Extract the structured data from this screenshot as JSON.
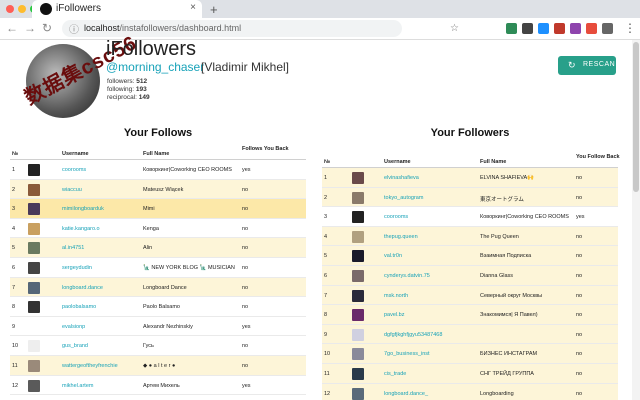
{
  "browser": {
    "tab_title": "iFollowers",
    "tab_close": "×",
    "new_tab": "+",
    "url_host": "localhost",
    "url_path": "/instafollowers/dashboard.html",
    "back": "←",
    "forward": "→",
    "reload": "↻",
    "secure_icon": "ⓘ",
    "star_icon": "☆",
    "menu_icon": "⋮"
  },
  "header": {
    "app_title": "iFollowers",
    "username": "@morning_chaser",
    "full_name": "[Vladimir Mikhel]",
    "stamp_text": "数据集csc56",
    "stats": {
      "followers_label": "followers:",
      "followers_value": "512",
      "following_label": "following:",
      "following_value": "193",
      "reciprocal_label": "reciprocal:",
      "reciprocal_value": "149"
    },
    "rescan_label": "RESCAN",
    "rescan_icon": "↻"
  },
  "follows": {
    "title": "Your Follows",
    "headers": {
      "num": "№",
      "pic": "",
      "username": "Username",
      "full_name": "Full Name",
      "back": "Follows You Back"
    },
    "rows": [
      {
        "n": "1",
        "username": "coorooms",
        "full_name": "Коворкинг|Coworking CEO ROOMS",
        "back": "yes",
        "color": "#222222",
        "hl": false
      },
      {
        "n": "2",
        "username": "wiaccuu",
        "full_name": "Mateusz Wiącek",
        "back": "no",
        "color": "#8a5a3a",
        "hl": true
      },
      {
        "n": "3",
        "username": "mimilongboarduk",
        "full_name": "Mimi",
        "back": "no",
        "color": "#4a3a5a",
        "hl": "strong"
      },
      {
        "n": "4",
        "username": "katie.kangaro.o",
        "full_name": "Kenga",
        "back": "no",
        "color": "#c9a060",
        "hl": false
      },
      {
        "n": "5",
        "username": "al.in4751",
        "full_name": "Alin",
        "back": "no",
        "color": "#6a7a60",
        "hl": true
      },
      {
        "n": "6",
        "username": "sergeydudin",
        "full_name": "🗽 NEW YORK BLOG 🗽 MUSICIAN",
        "back": "no",
        "color": "#444444",
        "hl": false
      },
      {
        "n": "7",
        "username": "longboard.dance",
        "full_name": "Longboard Dance",
        "back": "no",
        "color": "#556677",
        "hl": true
      },
      {
        "n": "8",
        "username": "paolobalsamo",
        "full_name": "Paolo Balsamo",
        "back": "no",
        "color": "#333333",
        "hl": false
      },
      {
        "n": "9",
        "username": "evalsionp",
        "full_name": "Alexandr Nezhinskiy",
        "back": "yes",
        "color": "#ffffff",
        "hl": false
      },
      {
        "n": "10",
        "username": "gus_brand",
        "full_name": "Гусь",
        "back": "no",
        "color": "#eeeeee",
        "hl": false
      },
      {
        "n": "11",
        "username": "wattergeoftheyfrenchie",
        "full_name": "◆ ● a l t e r ●",
        "back": "no",
        "color": "#9a8a7a",
        "hl": true
      },
      {
        "n": "12",
        "username": "mikhel.artem",
        "full_name": "Артем Михель",
        "back": "yes",
        "color": "#5a5a5a",
        "hl": false
      }
    ]
  },
  "followers": {
    "title": "Your Followers",
    "headers": {
      "num": "№",
      "pic": "",
      "username": "Username",
      "full_name": "Full Name",
      "back": "You Follow Back"
    },
    "rows": [
      {
        "n": "1",
        "username": "elvinashafieva",
        "full_name": "ELVINA SHAFIEVA🙌",
        "back": "no",
        "color": "#6a4a4a",
        "hl": true
      },
      {
        "n": "2",
        "username": "tokyo_autogram",
        "full_name": "東京オートグラム",
        "back": "no",
        "color": "#8a7a6a",
        "hl": true
      },
      {
        "n": "3",
        "username": "coorooms",
        "full_name": "Коворкинг|Coworking CEO ROOMS",
        "back": "yes",
        "color": "#222222",
        "hl": false
      },
      {
        "n": "4",
        "username": "thepug.queen",
        "full_name": "The Pug Queen",
        "back": "no",
        "color": "#b0a080",
        "hl": true
      },
      {
        "n": "5",
        "username": "val.tr0n",
        "full_name": "Взаимная Подписка",
        "back": "no",
        "color": "#1a1a2a",
        "hl": true
      },
      {
        "n": "6",
        "username": "cynderys.datvin.75",
        "full_name": "Dianna Glass",
        "back": "no",
        "color": "#7a6a6a",
        "hl": true
      },
      {
        "n": "7",
        "username": "msk.north",
        "full_name": "Северный округ Москвы",
        "back": "no",
        "color": "#2a2a3a",
        "hl": true
      },
      {
        "n": "8",
        "username": "pavel.bz",
        "full_name": "Знакомимся| Я Павел)",
        "back": "no",
        "color": "#6a2a6a",
        "hl": true
      },
      {
        "n": "9",
        "username": "dgfgfjkghfjgyu53487468",
        "full_name": "",
        "back": "no",
        "color": "#d0d0e0",
        "hl": true
      },
      {
        "n": "10",
        "username": "7go_business_inst",
        "full_name": "БИЗНЕС ИНСТАГРАМ",
        "back": "no",
        "color": "#8a8a9a",
        "hl": true
      },
      {
        "n": "11",
        "username": "cis_trade",
        "full_name": "СНГ ТРЕЙД ГРУППА",
        "back": "no",
        "color": "#2a3a4a",
        "hl": true
      },
      {
        "n": "12",
        "username": "longboard.dance_",
        "full_name": "Longboarding",
        "back": "no",
        "color": "#5a6a7a",
        "hl": true
      }
    ]
  },
  "colors": {
    "accent": "#17a2b8",
    "rescan": "#28a08a",
    "row_highlight": "#fdf5d8",
    "row_highlight_strong": "#fce8a8"
  }
}
